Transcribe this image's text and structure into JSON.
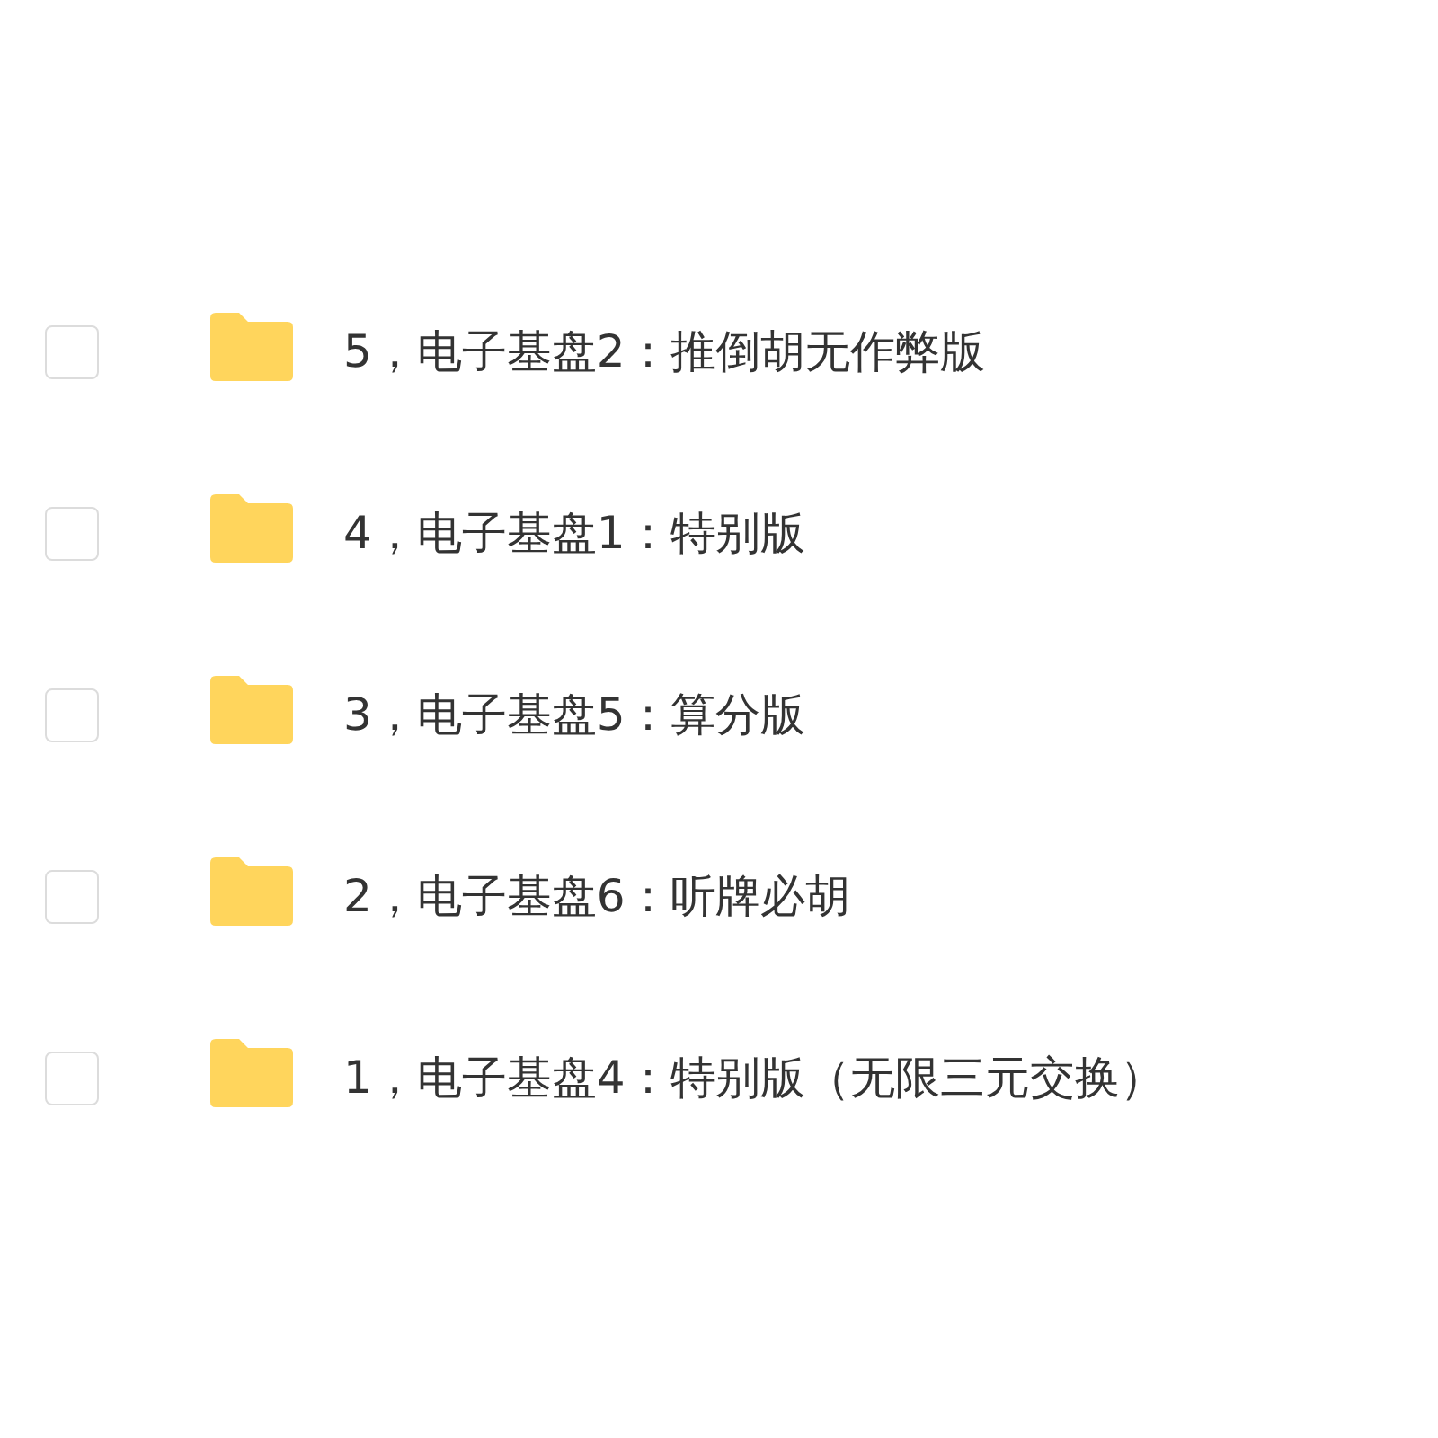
{
  "files": [
    {
      "name": "5，电子基盘2：推倒胡无作弊版",
      "checked": false
    },
    {
      "name": "4，电子基盘1：特别版",
      "checked": false
    },
    {
      "name": "3，电子基盘5：算分版",
      "checked": false
    },
    {
      "name": "2，电子基盘6：听牌必胡",
      "checked": false
    },
    {
      "name": "1，电子基盘4：特别版（无限三元交换）",
      "checked": false
    }
  ]
}
